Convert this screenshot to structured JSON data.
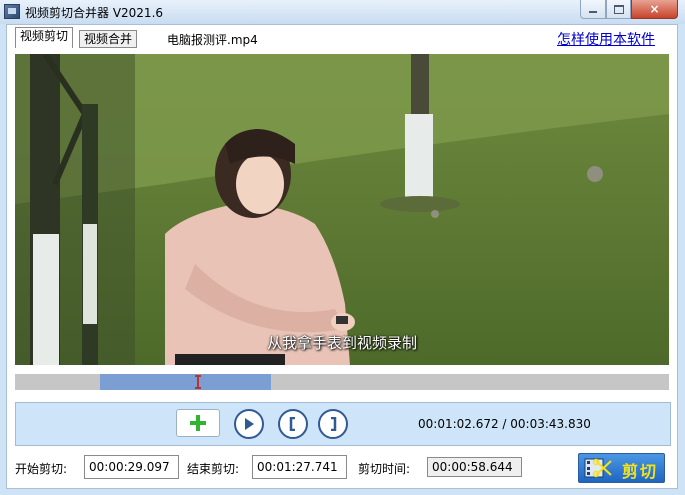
{
  "window": {
    "title": "视频剪切合并器 V2021.6",
    "buttons": {
      "min": "minimize",
      "max": "maximize",
      "close": "×"
    }
  },
  "tabs": [
    {
      "label": "视频剪切",
      "active": true
    },
    {
      "label": "视频合并",
      "active": false
    }
  ],
  "file": {
    "name": "电脑报测评.mp4"
  },
  "help": {
    "link_label": "怎样使用本软件"
  },
  "video": {
    "subtitle": "从我拿手表到视频录制"
  },
  "timeline": {
    "total_seconds": 223.83,
    "start_seconds": 29.097,
    "end_seconds": 87.741,
    "current_seconds": 62.672,
    "track_color": "#c6c6c6",
    "selection_color": "#7b9fd3",
    "playhead_color": "#c03030"
  },
  "controls": {
    "add_icon": "plus-icon",
    "play_icon": "play-icon",
    "mark_in_icon": "bracket-left-icon",
    "mark_out_icon": "bracket-right-icon",
    "time_readout": "00:01:02.672 / 00:03:43.830"
  },
  "bottom": {
    "start_label": "开始剪切:",
    "start_value": "00:00:29.097",
    "end_label": "结束剪切:",
    "end_value": "00:01:27.741",
    "duration_label": "剪切时间:",
    "duration_value": "00:00:58.644",
    "cut_button_label": "剪切"
  }
}
